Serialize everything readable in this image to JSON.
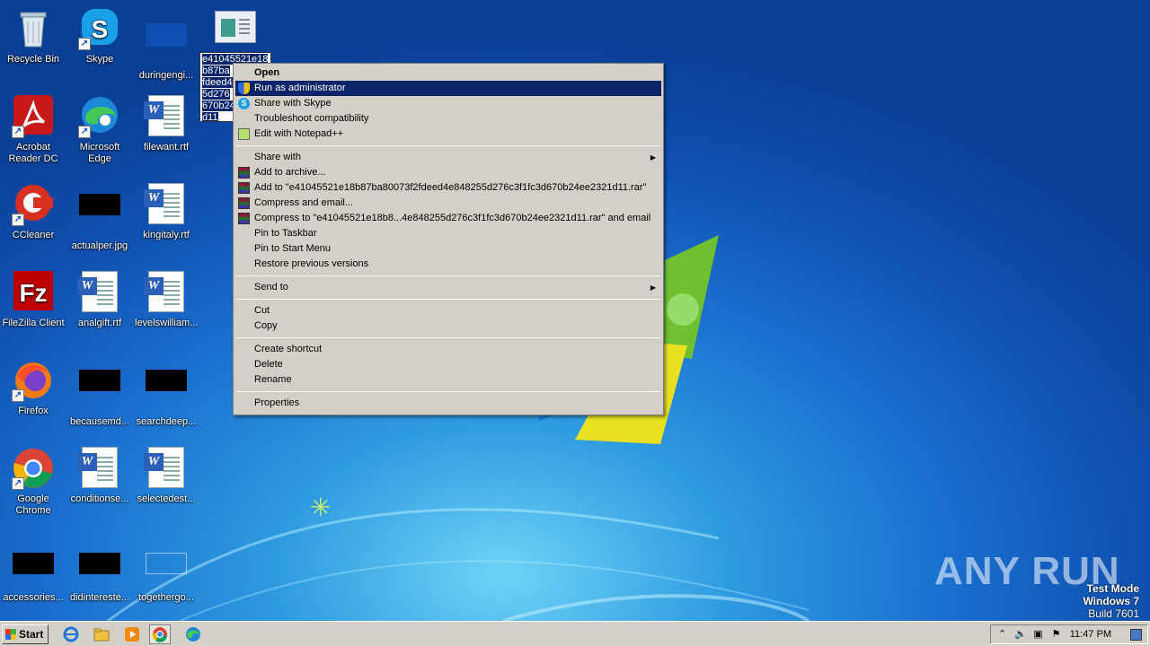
{
  "desktop": {
    "icons": [
      {
        "label": "Recycle Bin"
      },
      {
        "label": "Skype"
      },
      {
        "label": "duringengi..."
      },
      {
        "label": "Acrobat Reader DC"
      },
      {
        "label": "Microsoft Edge"
      },
      {
        "label": "filewant.rtf"
      },
      {
        "label": "CCleaner"
      },
      {
        "label": "actualper.jpg"
      },
      {
        "label": "kingitaly.rtf"
      },
      {
        "label": "FileZilla Client"
      },
      {
        "label": "analgift.rtf"
      },
      {
        "label": "levelswilliam..."
      },
      {
        "label": "Firefox"
      },
      {
        "label": "becausemd..."
      },
      {
        "label": "searchdeep..."
      },
      {
        "label": "Google Chrome"
      },
      {
        "label": "conditionse..."
      },
      {
        "label": "selectedest..."
      },
      {
        "label": "accessories..."
      },
      {
        "label": "didintereste..."
      },
      {
        "label": "togethergo..."
      }
    ],
    "selected_file": {
      "name_lines": [
        "e41045521e18",
        "b87ba",
        "fdeed4",
        "5d276",
        "670b24",
        "d11"
      ]
    }
  },
  "context_menu": {
    "items": [
      {
        "label": "Open"
      },
      {
        "label": "Run as administrator"
      },
      {
        "label": "Share with Skype"
      },
      {
        "label": "Troubleshoot compatibility"
      },
      {
        "label": "Edit with Notepad++"
      },
      {
        "label": "Share with"
      },
      {
        "label": "Add to archive..."
      },
      {
        "label": "Add to \"e41045521e18b87ba80073f2fdeed4e848255d276c3f1fc3d670b24ee2321d11.rar\""
      },
      {
        "label": "Compress and email..."
      },
      {
        "label": "Compress to \"e41045521e18b8...4e848255d276c3f1fc3d670b24ee2321d11.rar\" and email"
      },
      {
        "label": "Pin to Taskbar"
      },
      {
        "label": "Pin to Start Menu"
      },
      {
        "label": "Restore previous versions"
      },
      {
        "label": "Send to"
      },
      {
        "label": "Cut"
      },
      {
        "label": "Copy"
      },
      {
        "label": "Create shortcut"
      },
      {
        "label": "Delete"
      },
      {
        "label": "Rename"
      },
      {
        "label": "Properties"
      }
    ]
  },
  "taskbar": {
    "start_label": "Start",
    "clock": "11:47 PM"
  },
  "watermark": {
    "line1": "Test Mode",
    "line2": "Windows 7",
    "line3": "Build 7601",
    "brand": "ANY RUN"
  },
  "colors": {
    "highlight": "#0a246a",
    "menu_bg": "#d4d0c8"
  }
}
